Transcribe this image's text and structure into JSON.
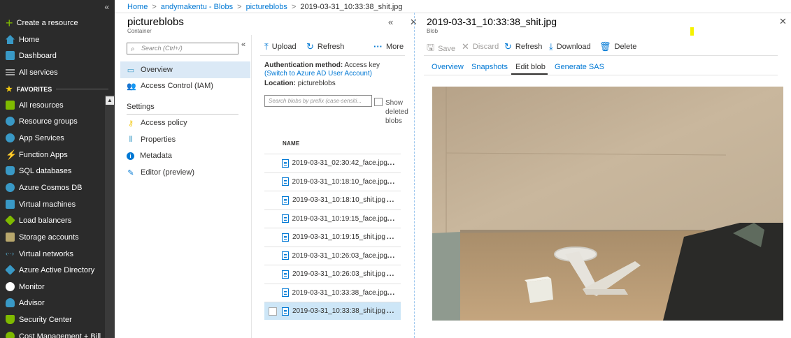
{
  "leftnav": {
    "collapse": "«",
    "create": "Create a resource",
    "home": "Home",
    "dashboard": "Dashboard",
    "all_services": "All services",
    "favorites": "FAVORITES",
    "items": [
      {
        "label": "All resources",
        "color": "#7fba00"
      },
      {
        "label": "Resource groups",
        "color": "#3999c6"
      },
      {
        "label": "App Services",
        "color": "#3999c6"
      },
      {
        "label": "Function Apps",
        "color": "#f2c811"
      },
      {
        "label": "SQL databases",
        "color": "#3999c6"
      },
      {
        "label": "Azure Cosmos DB",
        "color": "#3999c6"
      },
      {
        "label": "Virtual machines",
        "color": "#3999c6"
      },
      {
        "label": "Load balancers",
        "color": "#7fba00"
      },
      {
        "label": "Storage accounts",
        "color": "#b8a76c"
      },
      {
        "label": "Virtual networks",
        "color": "#59b4d9"
      },
      {
        "label": "Azure Active Directory",
        "color": "#3999c6"
      },
      {
        "label": "Monitor",
        "color": "#ffffff"
      },
      {
        "label": "Advisor",
        "color": "#3999c6"
      },
      {
        "label": "Security Center",
        "color": "#7fba00"
      },
      {
        "label": "Cost Management + Bill",
        "color": "#7fba00"
      }
    ]
  },
  "breadcrumb": {
    "home": "Home",
    "account": "andymakentu - Blobs",
    "container": "pictureblobs",
    "blob": "2019-03-31_10:33:38_shit.jpg",
    "sep": ">"
  },
  "container_blade": {
    "title": "pictureblobs",
    "subtitle": "Container",
    "controls": "« ✕",
    "search_placeholder": "Search (Ctrl+/)",
    "menu_collapse": "«",
    "menu": {
      "overview": "Overview",
      "access_control": "Access Control (IAM)",
      "settings": "Settings",
      "access_policy": "Access policy",
      "properties": "Properties",
      "metadata": "Metadata",
      "editor": "Editor (preview)"
    },
    "toolbar": {
      "upload": "Upload",
      "refresh": "Refresh",
      "more": "More"
    },
    "auth_label": "Authentication method:",
    "auth_value": "Access key",
    "auth_link": "(Switch to Azure AD User Account)",
    "location_label": "Location:",
    "location_value": "pictureblobs",
    "blob_search_placeholder": "Search blobs by prefix (case-sensiti...",
    "show_deleted": "Show deleted blobs",
    "column_name": "NAME",
    "blobs": [
      "2019-03-31_02:30:42_face.jpg",
      "2019-03-31_10:18:10_face.jpg",
      "2019-03-31_10:18:10_shit.jpg",
      "2019-03-31_10:19:15_face.jpg",
      "2019-03-31_10:19:15_shit.jpg",
      "2019-03-31_10:26:03_face.jpg",
      "2019-03-31_10:26:03_shit.jpg",
      "2019-03-31_10:33:38_face.jpg",
      "2019-03-31_10:33:38_shit.jpg"
    ],
    "selected_blob_index": 8,
    "row_more": "..."
  },
  "blob_blade": {
    "title": "2019-03-31_10:33:38_shit.jpg",
    "subtitle": "Blob",
    "close": "✕",
    "toolbar": {
      "save": "Save",
      "discard": "Discard",
      "refresh": "Refresh",
      "download": "Download",
      "delete": "Delete"
    },
    "tabs": [
      "Overview",
      "Snapshots",
      "Edit blob",
      "Generate SAS"
    ],
    "active_tab": "Edit blob"
  },
  "colors": {
    "accent": "#0078d4",
    "nav_bg": "#2b2b2b",
    "selected_row": "#cde6f7",
    "active_menu": "#dbe9f6"
  }
}
